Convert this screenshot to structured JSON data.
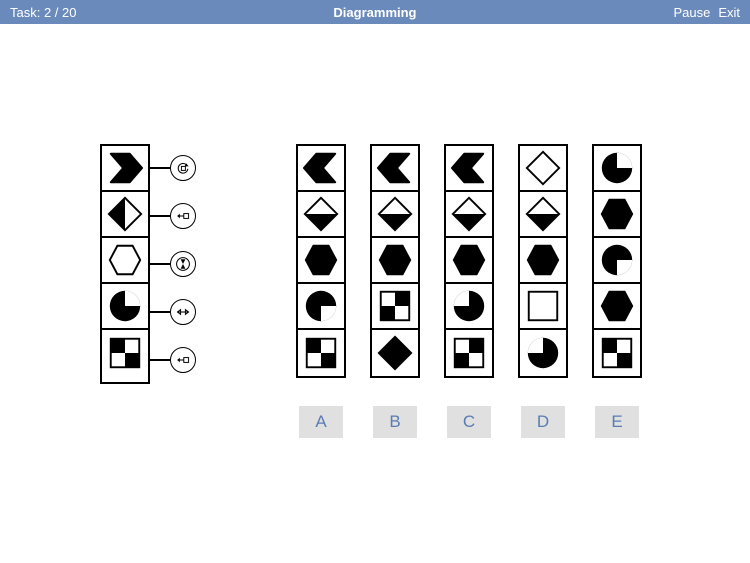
{
  "header": {
    "task_label": "Task: 2 / 20",
    "title": "Diagramming",
    "pause": "Pause",
    "exit": "Exit"
  },
  "source_column": [
    {
      "shape": "hex-pointed-right-black"
    },
    {
      "shape": "diamond-left-black"
    },
    {
      "shape": "hexagon-outline"
    },
    {
      "shape": "circle-notch-tr-white"
    },
    {
      "shape": "square-checker-diag"
    }
  ],
  "operations": [
    {
      "icon": "rotate-ccw-square"
    },
    {
      "icon": "arrow-left-square"
    },
    {
      "icon": "hourglass"
    },
    {
      "icon": "swap-horizontal"
    },
    {
      "icon": "arrow-left-square"
    }
  ],
  "answers": [
    {
      "label": "A",
      "cells": [
        "hex-pointed-left-black",
        "diamond-top-white",
        "hexagon-black",
        "circle-notch-br-white",
        "square-checker-diag"
      ]
    },
    {
      "label": "B",
      "cells": [
        "hex-pointed-left-black",
        "diamond-bottom-black",
        "hexagon-black",
        "square-checker",
        "diamond-full-black"
      ]
    },
    {
      "label": "C",
      "cells": [
        "hex-pointed-left-black",
        "diamond-top-white",
        "hexagon-black",
        "circle-notch-tl-white",
        "square-checker"
      ]
    },
    {
      "label": "D",
      "cells": [
        "diamond-outline",
        "diamond-bottom-black",
        "hexagon-black",
        "square-outline",
        "circle-notch-tr-black"
      ]
    },
    {
      "label": "E",
      "cells": [
        "circle-notch-tr-white-alt",
        "hexagon-black",
        "circle-notch-br-white",
        "hexagon-black",
        "square-checker-diag"
      ]
    }
  ]
}
